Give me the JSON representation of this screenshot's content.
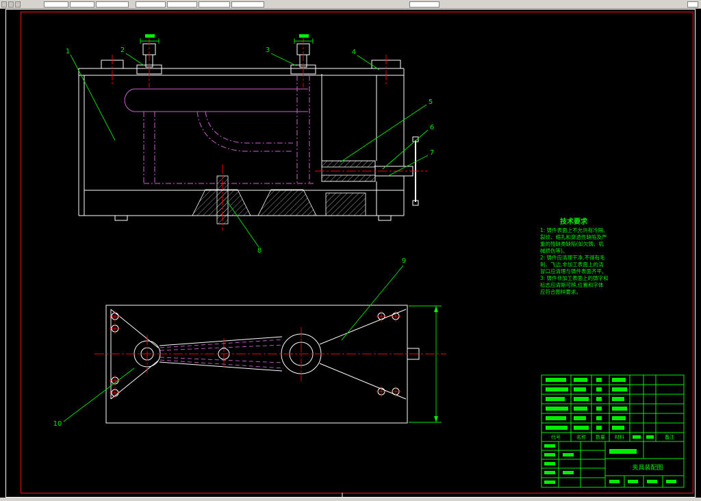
{
  "callouts": [
    "1",
    "2",
    "3",
    "4",
    "5",
    "6",
    "7",
    "8",
    "9",
    "10"
  ],
  "tech_req": {
    "title": "技术要求",
    "lines": [
      "1: 铸件表面上不允许有冷隔、",
      "裂纹、缩孔和穿透性缺陷及严",
      "重的残缺类缺陷(如欠铸、机",
      "械损伤等)。",
      "2: 铸件应清理干净,不得有毛",
      "刺、飞边,非加工表面上的浇",
      "冒口应清理与铸件表面齐平。",
      "3: 铸件非加工表面上的铸字和",
      "标志应清晰可辨,位置和字体",
      "应符合图样要求。"
    ]
  },
  "bom": {
    "headers": [
      "代号",
      "名称",
      "数量",
      "材料",
      "备注"
    ]
  },
  "title_block": {
    "drawing_title": "夹具装配图"
  },
  "colors": {
    "background": "#000000",
    "outline_white": "#ffffff",
    "centerline_red": "#ff0000",
    "phantom_magenta": "#cf5fd4",
    "annotation_green": "#00ee00",
    "frame_red": "#b01010",
    "toolbar_gray": "#d6d3ce"
  }
}
